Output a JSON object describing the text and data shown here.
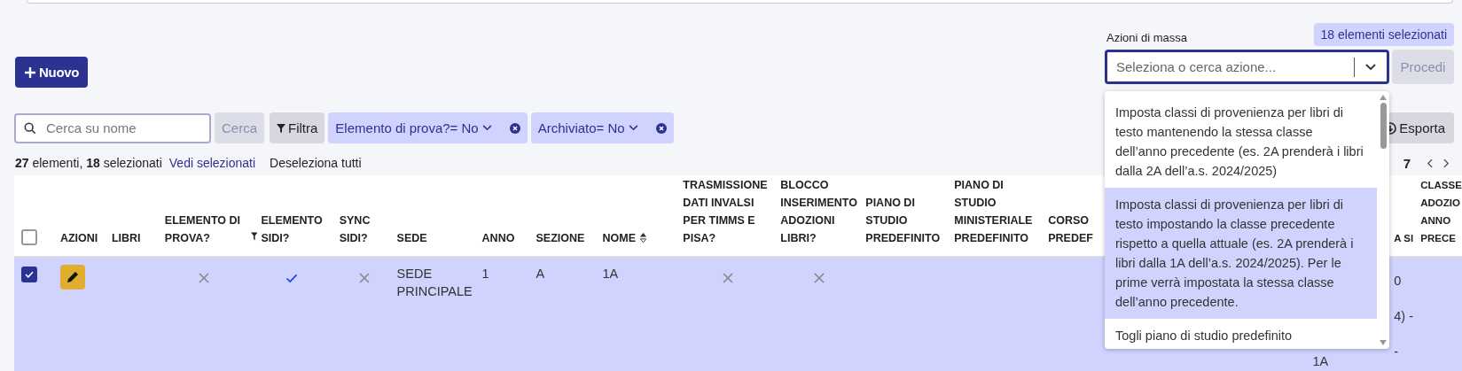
{
  "new_button": {
    "label": "Nuovo"
  },
  "mass_actions": {
    "label": "Azioni di massa",
    "badge": "18 elementi selezionati",
    "select": {
      "placeholder": "Seleziona o cerca azione...",
      "expanded": true
    },
    "proceed_button": {
      "label": "Procedi",
      "disabled": true
    },
    "options": [
      {
        "label": "Imposta classi di provenienza per libri di testo mantenendo la stessa classe dell’anno precedente (es. 2A prenderà i libri dalla 2A dell’a.s. 2024/2025)",
        "selected": false
      },
      {
        "label": "Imposta classi di provenienza per libri di testo impostando la classe precedente rispetto a quella attuale (es. 2A prenderà i libri dalla 1A dell’a.s. 2024/2025). Per le prime verrà impostata la stessa classe dell’anno precedente.",
        "selected": true
      },
      {
        "label": "Togli piano di studio predefinito",
        "selected": false
      }
    ]
  },
  "search": {
    "placeholder": "Cerca su nome",
    "button": {
      "label": "Cerca",
      "disabled": true
    }
  },
  "filter_button": {
    "label": "Filtra"
  },
  "filters": [
    {
      "label": "Elemento di prova?= No"
    },
    {
      "label": "Archiviato= No"
    }
  ],
  "export_button": {
    "label": "Esporta"
  },
  "summary": {
    "text": "**27** elementi, **18** selezionati",
    "view_selected": "Vedi selezionati",
    "deselect_all": "Deseleziona tutti"
  },
  "pagination": {
    "range": "7"
  },
  "table": {
    "all_selected": false,
    "columns": [
      {
        "label": "AZIONI"
      },
      {
        "label": "LIBRI"
      },
      {
        "label": "ELEMENTO DI PROVA?"
      },
      {
        "label": "ELEMENTO SIDI?",
        "filtered": true
      },
      {
        "label": "SYNC SIDI?"
      },
      {
        "label": "SEDE"
      },
      {
        "label": "ANNO"
      },
      {
        "label": "SEZIONE"
      },
      {
        "label": "NOME",
        "sortable": true
      },
      {
        "label": "TRASMISSIONE DATI INVALSI PER TIMMS E PISA?"
      },
      {
        "label": "BLOCCO INSERIMENTO ADOZIONI LIBRI?"
      },
      {
        "label": "PIANO DI STUDIO PREDEFINITO"
      },
      {
        "label": "PIANO DI STUDIO MINISTERIALE PREDEFINITO"
      },
      {
        "label": "CORSO PREDEF"
      },
      {},
      {
        "label": "A SI"
      },
      {
        "label": "CLASSE ADOZIO ANNO PRECE"
      }
    ],
    "rows": [
      {
        "selected": true,
        "cells": [
          {
            "kind": "edit"
          },
          {
            "kind": "empty"
          },
          {
            "kind": "bool",
            "value": false
          },
          {
            "kind": "bool",
            "value": true
          },
          {
            "kind": "bool",
            "value": false
          },
          {
            "kind": "text",
            "text": "SEDE PRINCIPALE"
          },
          {
            "kind": "text",
            "text": "1"
          },
          {
            "kind": "text",
            "text": "A"
          },
          {
            "kind": "text",
            "text": "1A"
          },
          {
            "kind": "bool",
            "value": false
          },
          {
            "kind": "bool",
            "value": false
          },
          {
            "kind": "empty"
          },
          {
            "kind": "empty"
          },
          {
            "kind": "empty"
          },
          {
            "kind": "bottom",
            "text": "1A"
          },
          {
            "kind": "lines",
            "lines": [
              "0",
              "4) -",
              "-"
            ]
          },
          {
            "kind": "empty"
          }
        ]
      }
    ]
  }
}
